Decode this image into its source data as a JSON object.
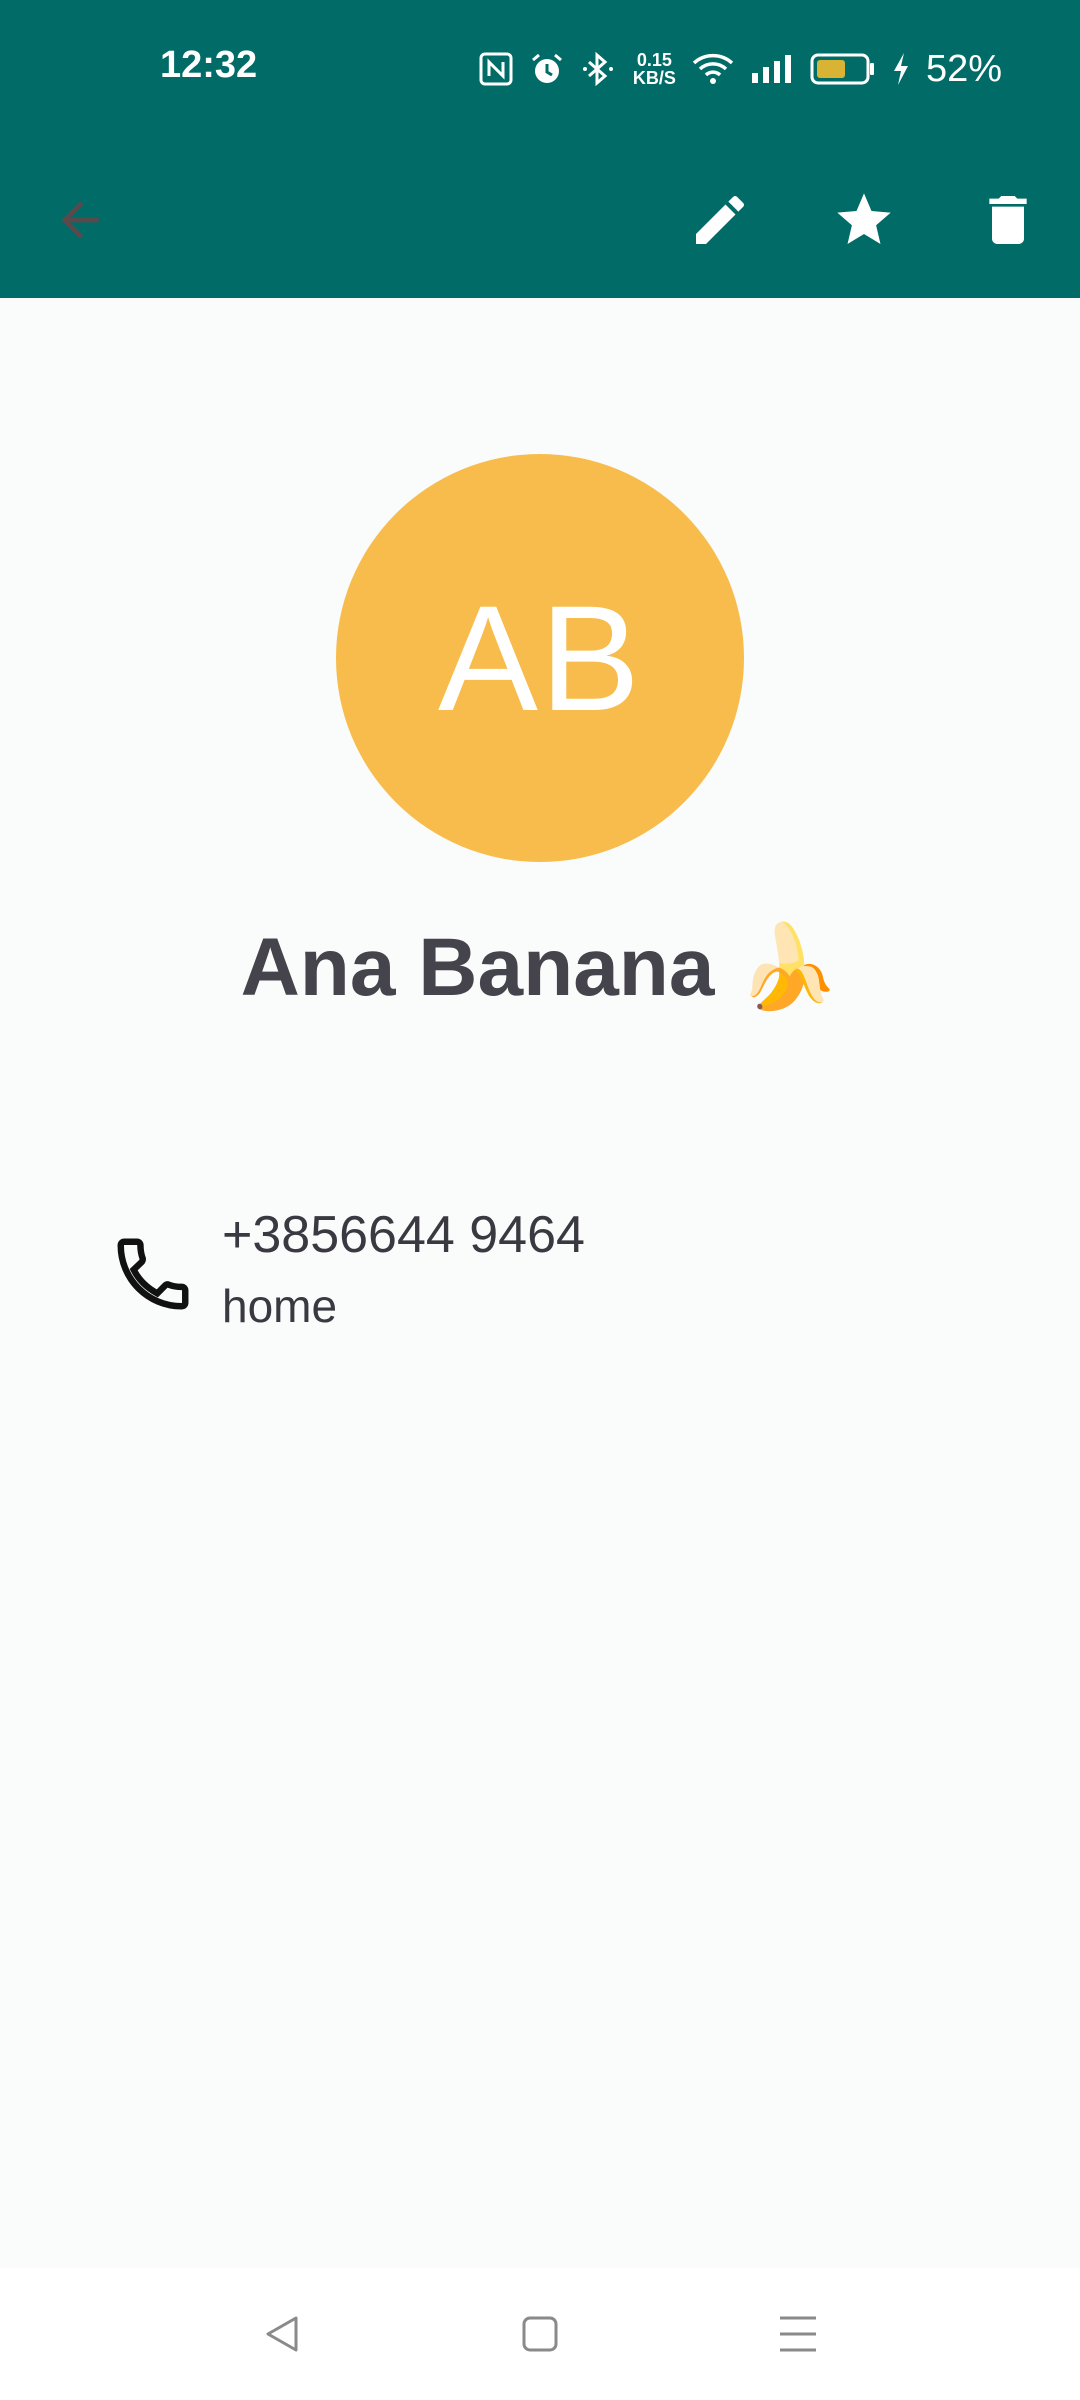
{
  "status_bar": {
    "time": "12:32",
    "network_speed_value": "0.15",
    "network_speed_unit": "KB/S",
    "battery_percent": "52%",
    "icons": [
      "nfc-icon",
      "alarm-icon",
      "bluetooth-icon",
      "wifi-icon",
      "signal-icon",
      "battery-icon",
      "charging-icon"
    ]
  },
  "toolbar": {
    "actions": [
      "back-icon",
      "edit-icon",
      "star-icon",
      "delete-icon"
    ],
    "color": "#016c67"
  },
  "contact": {
    "initials": "AB",
    "name": "Ana Banana 🍌",
    "avatar_color": "#f8bc4c",
    "phone": {
      "number": "+3856644 9464",
      "type": "home"
    }
  },
  "nav_bar": {
    "buttons": [
      "nav-back-icon",
      "nav-home-icon",
      "nav-recents-icon"
    ]
  }
}
